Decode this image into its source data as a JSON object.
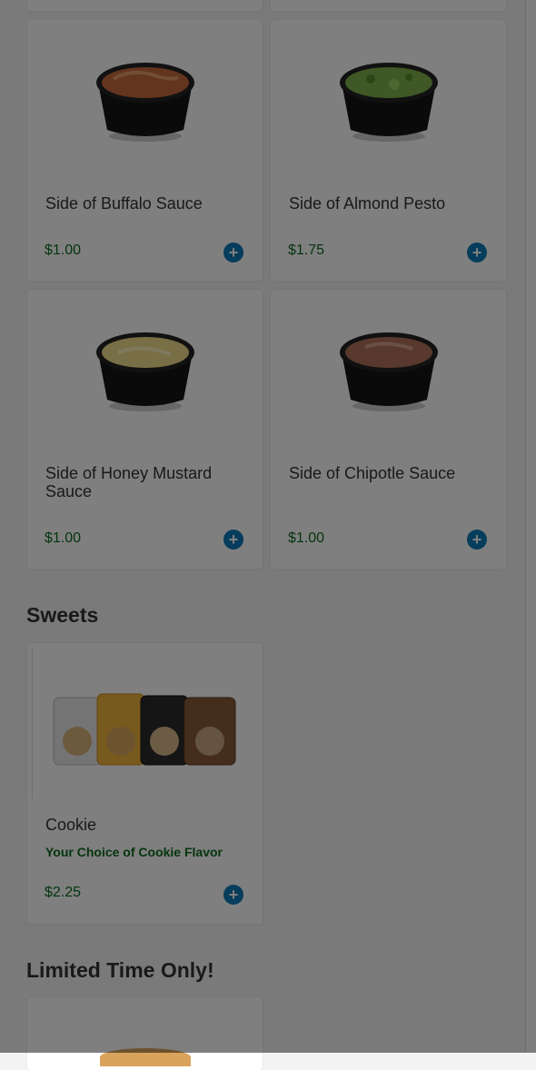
{
  "products": [
    {
      "name": "Side of Buffalo Sauce",
      "price": "$1.00",
      "icon": "buffalo-sauce-cup",
      "sauce_color": "#c96a3c"
    },
    {
      "name": "Side of Almond Pesto",
      "price": "$1.75",
      "icon": "almond-pesto-cup",
      "sauce_color": "#7fb04a"
    },
    {
      "name": "Side of Honey Mustard Sauce",
      "price": "$1.00",
      "icon": "honey-mustard-cup",
      "sauce_color": "#f2df8c"
    },
    {
      "name": "Side of Chipotle Sauce",
      "price": "$1.00",
      "icon": "chipotle-sauce-cup",
      "sauce_color": "#b3735a"
    }
  ],
  "sweets": {
    "title": "Sweets",
    "item": {
      "name": "Cookie",
      "subtitle": "Your Choice of Cookie Flavor",
      "price": "$2.25",
      "icon": "cookie-bags"
    }
  },
  "limited": {
    "title": "Limited Time Only!"
  },
  "colors": {
    "price": "#0a6b1d",
    "add_button": "#0e7ab8",
    "overlay": "rgba(0,0,0,0.5)"
  },
  "add_icon": "+"
}
